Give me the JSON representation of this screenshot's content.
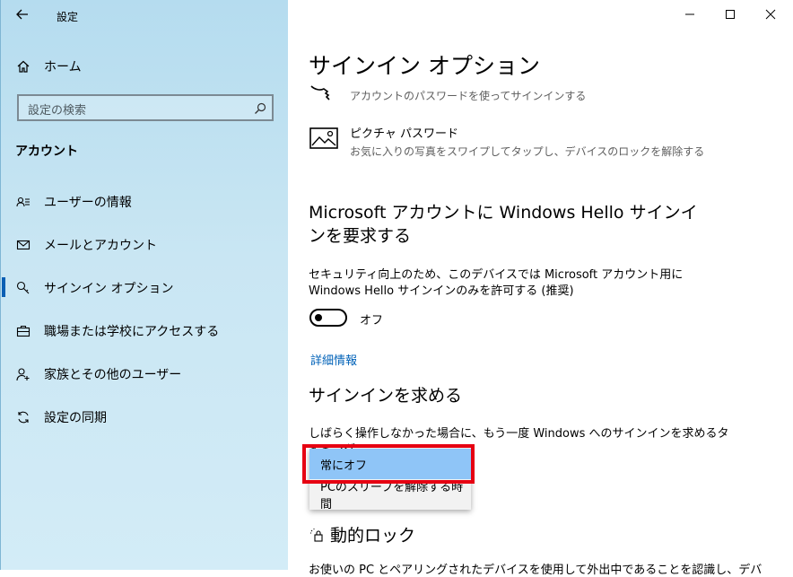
{
  "window": {
    "title": "設定",
    "minimize": "—",
    "maximize": "☐",
    "close": "✕"
  },
  "sidebar": {
    "home": "ホーム",
    "search_placeholder": "設定の検索",
    "section": "アカウント",
    "items": [
      {
        "label": "ユーザーの情報",
        "icon": "user-info-icon"
      },
      {
        "label": "メールとアカウント",
        "icon": "mail-icon"
      },
      {
        "label": "サインイン オプション",
        "icon": "key-icon",
        "selected": true
      },
      {
        "label": "職場または学校にアクセスする",
        "icon": "briefcase-icon"
      },
      {
        "label": "家族とその他のユーザー",
        "icon": "person-add-icon"
      },
      {
        "label": "設定の同期",
        "icon": "sync-icon"
      }
    ]
  },
  "main": {
    "title": "サインイン オプション",
    "password_option": {
      "subtitle": "アカウントのパスワードを使ってサインインする"
    },
    "picture_password": {
      "title": "ピクチャ パスワード",
      "subtitle": "お気に入りの写真をスワイプしてタップし、デバイスのロックを解除する"
    },
    "hello_section": {
      "heading": "Microsoft アカウントに Windows Hello サインインを要求する",
      "description": "セキュリティ向上のため、このデバイスでは Microsoft アカウント用に Windows Hello サインインのみを許可する (推奨)",
      "toggle_label": "オフ",
      "toggle_on": false,
      "link": "詳細情報"
    },
    "require_signin": {
      "heading": "サインインを求める",
      "description": "しばらく操作しなかった場合に、もう一度 Windows へのサインインを求めるタイミング",
      "options": [
        "常にオフ",
        "PCのスリープを解除する時間"
      ],
      "selected": "常にオフ"
    },
    "dynamic_lock": {
      "heading": "動的ロック",
      "description": "お使いの PC とペアリングされたデバイスを使用して外出中であることを認識し、デバ"
    }
  },
  "colors": {
    "accent": "#0a5fb4",
    "highlight_border": "#e60012",
    "selected_option": "#8fc5f7"
  }
}
